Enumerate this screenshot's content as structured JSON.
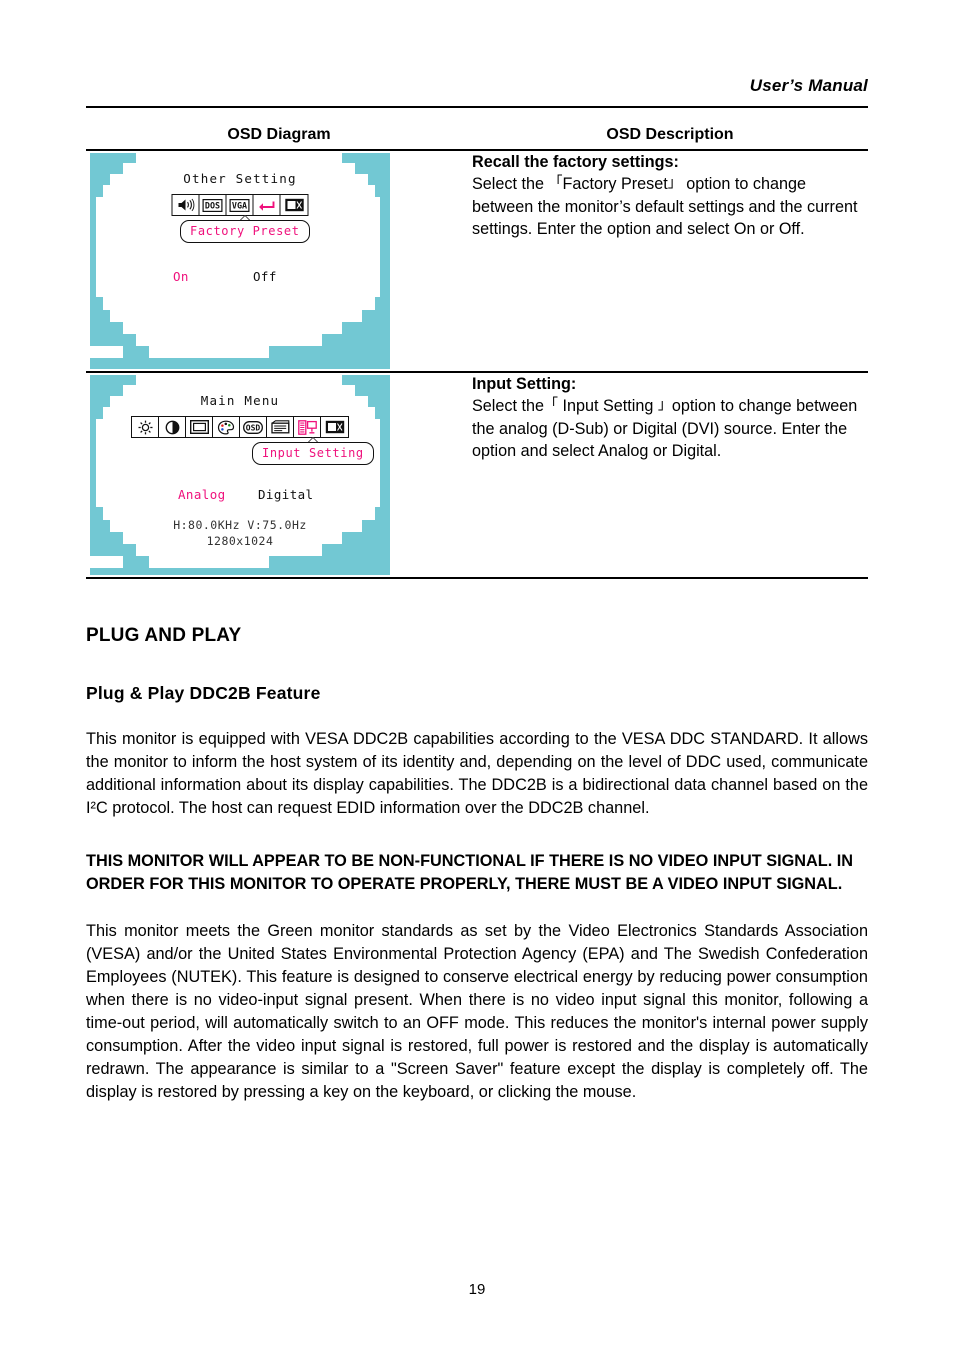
{
  "header": {
    "title": "User’s Manual"
  },
  "osd_table": {
    "columns": [
      "OSD Diagram",
      "OSD Description"
    ],
    "rows": [
      {
        "diagram": {
          "menu_title": "Other Setting",
          "icons": [
            "speaker-icon",
            "dos-icon",
            "vga-icon",
            "return-arrow-icon",
            "exit-icon"
          ],
          "selected_icon_index": 3,
          "callout": "Factory Preset",
          "options": [
            "On",
            "Off"
          ],
          "selected_option": "On"
        },
        "description": {
          "title": "Recall the factory settings:",
          "text": "Select the 「Factory Preset」option to change between the monitor’s default settings and the current settings. Enter the option and select On or Off.",
          "pre_bracket": "Select the  ",
          "bracket_open": "「",
          "bracket_label": "Factory Preset",
          "bracket_close": "」",
          "post_bracket": " option to change between the monitor’s default settings and the current settings. Enter the option and select On or Off."
        }
      },
      {
        "diagram": {
          "menu_title": "Main Menu",
          "icons": [
            "brightness-icon",
            "contrast-icon",
            "geometry-icon",
            "color-icon",
            "osd-icon",
            "tools-icon",
            "input-setting-icon",
            "exit-icon"
          ],
          "selected_icon_index": 6,
          "callout": "Input Setting",
          "options": [
            "Analog",
            "Digital"
          ],
          "selected_option": "Analog",
          "frequency": "H:80.0KHz V:75.0Hz",
          "resolution": "1280x1024"
        },
        "description": {
          "title": "Input Setting:",
          "text": "Select the 「Input Setting」option to change between the analog (D-Sub) or Digital (DVI) source. Enter the option and select Analog or Digital.",
          "pre_bracket": "Select the",
          "bracket_open": "「",
          "bracket_label": " Input Setting ",
          "bracket_close": "」",
          "post_bracket": "option to change between the analog (D-Sub) or Digital (DVI) source. Enter the option and select Analog or Digital."
        }
      }
    ]
  },
  "sections": {
    "heading": "PLUG AND PLAY",
    "subheading": "Plug & Play DDC2B Feature",
    "paragraph1": "This monitor is equipped with VESA DDC2B capabilities according to the VESA DDC STANDARD. It allows the monitor to inform the host system of its identity and, depending on the level of DDC used, communicate additional information about its display capabilities. The DDC2B is a bidirectional data channel based on the I²C protocol. The host can request EDID information over the DDC2B channel.",
    "warning": "THIS MONITOR WILL APPEAR TO BE NON-FUNCTIONAL IF THERE IS NO VIDEO INPUT SIGNAL. IN ORDER FOR THIS MONITOR TO OPERATE PROPERLY, THERE MUST BE A VIDEO INPUT SIGNAL.",
    "paragraph2": "This monitor meets the Green monitor standards as set by the Video Electronics Standards Association (VESA) and/or the United States Environmental Protection Agency (EPA) and The Swedish Confederation Employees (NUTEK). This feature is designed to conserve electrical energy by reducing power consumption when there is no video-input signal present. When there is no video input signal this monitor, following a time-out period, will automatically switch to an OFF mode. This reduces the monitor's internal power supply consumption. After the video input signal is restored, full power is restored and the display is automatically redrawn. The appearance is similar to a \"Screen Saver\" feature except the display is completely off. The display is restored by pressing a key on the keyboard, or clicking the mouse."
  },
  "footer": {
    "page_number": "19"
  },
  "colors": {
    "osd_teal": "#72c8d3",
    "osd_pink": "#ef117c",
    "text": "#000000"
  }
}
